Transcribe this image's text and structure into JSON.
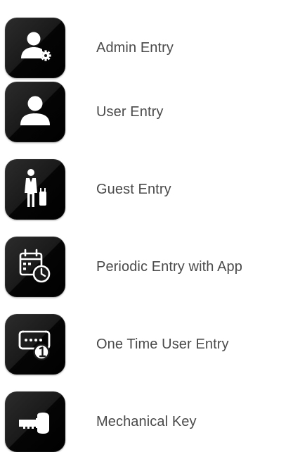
{
  "entries": [
    {
      "label": "Admin Entry",
      "icon": "admin-user-gear-icon"
    },
    {
      "label": "User Entry",
      "icon": "user-icon"
    },
    {
      "label": "Guest Entry",
      "icon": "guest-luggage-icon"
    },
    {
      "label": "Periodic Entry with App",
      "icon": "calendar-clock-icon"
    },
    {
      "label": "One Time User Entry",
      "icon": "one-time-code-icon"
    },
    {
      "label": "Mechanical Key",
      "icon": "key-icon"
    }
  ],
  "colors": {
    "tile_dark": "#000000",
    "tile_light": "#2c2c2c",
    "icon": "#ffffff",
    "label_text": "#4a4a4a"
  }
}
